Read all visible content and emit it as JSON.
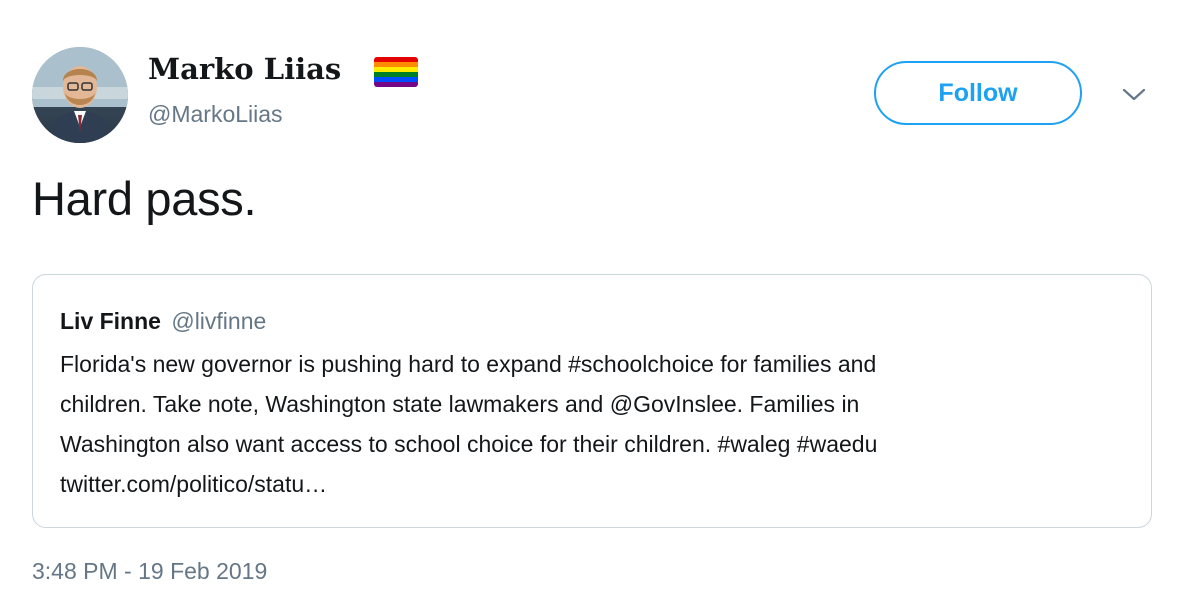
{
  "author": {
    "name": "Marko Liias",
    "handle": "@MarkoLiias",
    "flag_colors": [
      "#e40303",
      "#ff8c00",
      "#ffed00",
      "#008026",
      "#004dff",
      "#750787"
    ]
  },
  "actions": {
    "follow_label": "Follow",
    "menu_icon": "chevron-down-icon"
  },
  "tweet": {
    "text": "Hard pass.",
    "timestamp": "3:48 PM - 19 Feb 2019"
  },
  "quoted_tweet": {
    "name": "Liv Finne",
    "handle": "@livfinne",
    "lines": [
      "Florida's new governor is pushing hard to expand #schoolchoice for families and",
      "children. Take note, Washington state lawmakers and @GovInslee. Families in",
      "Washington also want access to school choice for their children. #waleg #waedu",
      "twitter.com/politico/statu…"
    ]
  },
  "colors": {
    "accent": "#1da1f2",
    "secondary_text": "#657786",
    "border": "#ccd6dd"
  }
}
